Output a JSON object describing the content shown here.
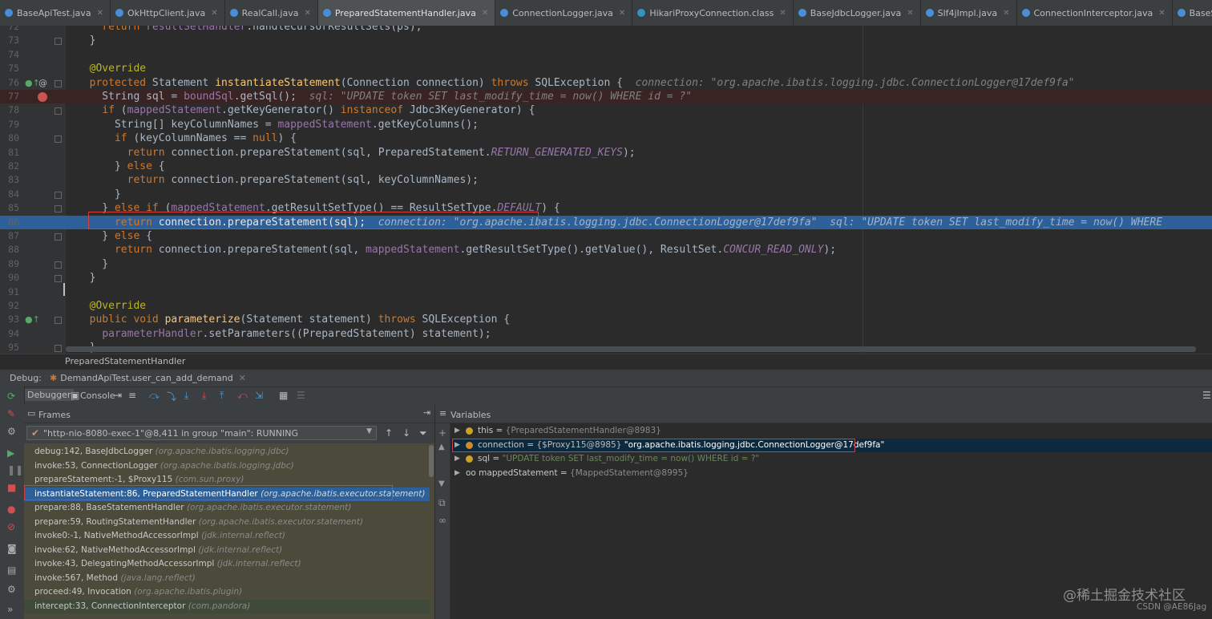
{
  "tabs": [
    {
      "label": "BaseApiTest.java",
      "icon": "java-class-icon"
    },
    {
      "label": "OkHttpClient.java",
      "icon": "java-class-icon"
    },
    {
      "label": "RealCall.java",
      "icon": "java-class-icon"
    },
    {
      "label": "PreparedStatementHandler.java",
      "icon": "java-class-icon",
      "active": true
    },
    {
      "label": "ConnectionLogger.java",
      "icon": "java-class-icon"
    },
    {
      "label": "HikariProxyConnection.class",
      "icon": "class-file-icon"
    },
    {
      "label": "BaseJdbcLogger.java",
      "icon": "java-class-icon"
    },
    {
      "label": "Slf4jImpl.java",
      "icon": "java-class-icon"
    },
    {
      "label": "ConnectionInterceptor.java",
      "icon": "java-class-icon"
    },
    {
      "label": "BaseStatementHandler.java",
      "icon": "java-class-icon"
    }
  ],
  "editor": {
    "lines": [
      {
        "n": "72",
        "t": "    return resultSetHandler.handleCursorResultSets(ps);"
      },
      {
        "n": "73",
        "t": "  }"
      },
      {
        "n": "74",
        "t": ""
      },
      {
        "n": "75",
        "t": "  @Override"
      },
      {
        "n": "76",
        "t": "  protected Statement instantiateStatement(Connection connection) throws SQLException {",
        "inline": "connection: \"org.apache.ibatis.logging.jdbc.ConnectionLogger@17def9fa\""
      },
      {
        "n": "77",
        "t": "    String sql = boundSql.getSql();",
        "inline": "sql: \"UPDATE token SET last_modify_time = now() WHERE id = ?\""
      },
      {
        "n": "78",
        "t": "    if (mappedStatement.getKeyGenerator() instanceof Jdbc3KeyGenerator) {"
      },
      {
        "n": "79",
        "t": "      String[] keyColumnNames = mappedStatement.getKeyColumns();"
      },
      {
        "n": "80",
        "t": "      if (keyColumnNames == null) {"
      },
      {
        "n": "81",
        "t": "        return connection.prepareStatement(sql, PreparedStatement.RETURN_GENERATED_KEYS);"
      },
      {
        "n": "82",
        "t": "      } else {"
      },
      {
        "n": "83",
        "t": "        return connection.prepareStatement(sql, keyColumnNames);"
      },
      {
        "n": "84",
        "t": "      }"
      },
      {
        "n": "85",
        "t": "    } else if (mappedStatement.getResultSetType() == ResultSetType.DEFAULT) {"
      },
      {
        "n": "86",
        "t": "      return connection.prepareStatement(sql);",
        "inline": "connection: \"org.apache.ibatis.logging.jdbc.ConnectionLogger@17def9fa\"  sql: \"UPDATE token SET last_modify_time = now() WHERE"
      },
      {
        "n": "87",
        "t": "    } else {"
      },
      {
        "n": "88",
        "t": "      return connection.prepareStatement(sql, mappedStatement.getResultSetType().getValue(), ResultSet.CONCUR_READ_ONLY);"
      },
      {
        "n": "89",
        "t": "    }"
      },
      {
        "n": "90",
        "t": "  }"
      },
      {
        "n": "91",
        "t": ""
      },
      {
        "n": "92",
        "t": "  @Override"
      },
      {
        "n": "93",
        "t": "  public void parameterize(Statement statement) throws SQLException {"
      },
      {
        "n": "94",
        "t": "    parameterHandler.setParameters((PreparedStatement) statement);"
      },
      {
        "n": "95",
        "t": "  }"
      }
    ]
  },
  "breadcrumb": "PreparedStatementHandler",
  "debug": {
    "label": "Debug:",
    "session": "DemandApiTest.user_can_add_demand",
    "tabs": {
      "debugger": "Debugger",
      "console": "Console"
    }
  },
  "frames": {
    "title": "Frames",
    "thread": "\"http-nio-8080-exec-1\"@8,411 in group \"main\": RUNNING",
    "list": [
      {
        "m": "debug:142, BaseJdbcLogger",
        "p": "(org.apache.ibatis.logging.jdbc)"
      },
      {
        "m": "invoke:53, ConnectionLogger",
        "p": "(org.apache.ibatis.logging.jdbc)"
      },
      {
        "m": "prepareStatement:-1, $Proxy115",
        "p": "(com.sun.proxy)"
      },
      {
        "m": "instantiateStatement:86, PreparedStatementHandler",
        "p": "(org.apache.ibatis.executor.statement)"
      },
      {
        "m": "prepare:88, BaseStatementHandler",
        "p": "(org.apache.ibatis.executor.statement)"
      },
      {
        "m": "prepare:59, RoutingStatementHandler",
        "p": "(org.apache.ibatis.executor.statement)"
      },
      {
        "m": "invoke0:-1, NativeMethodAccessorImpl",
        "p": "(jdk.internal.reflect)"
      },
      {
        "m": "invoke:62, NativeMethodAccessorImpl",
        "p": "(jdk.internal.reflect)"
      },
      {
        "m": "invoke:43, DelegatingMethodAccessorImpl",
        "p": "(jdk.internal.reflect)"
      },
      {
        "m": "invoke:567, Method",
        "p": "(java.lang.reflect)"
      },
      {
        "m": "proceed:49, Invocation",
        "p": "(org.apache.ibatis.plugin)"
      },
      {
        "m": "intercept:33, ConnectionInterceptor",
        "p": "(com.pandora)"
      }
    ]
  },
  "variables": {
    "title": "Variables",
    "list": [
      {
        "arrow": "▶",
        "icon": "#c9a227",
        "name": "this",
        "val": " = ",
        "type": "{PreparedStatementHandler@8983}",
        "str": ""
      },
      {
        "arrow": "▶",
        "icon": "#d08a2a",
        "name": "connection",
        "val": " = ",
        "type": "{$Proxy115@8985}",
        "str": " \"org.apache.ibatis.logging.jdbc.ConnectionLogger@17def9fa\"",
        "sel": true
      },
      {
        "arrow": "▶",
        "icon": "#c9a227",
        "name": "sql",
        "val": " = ",
        "type": "",
        "str": "\"UPDATE token SET last_modify_time = now() WHERE id = ?\""
      },
      {
        "arrow": "▶",
        "icon": "",
        "name": "oo mappedStatement",
        "val": " = ",
        "type": "{MappedStatement@8995}",
        "str": ""
      }
    ]
  },
  "watermark": "@稀土掘金技术社区",
  "credit": "CSDN @AE86Jag"
}
